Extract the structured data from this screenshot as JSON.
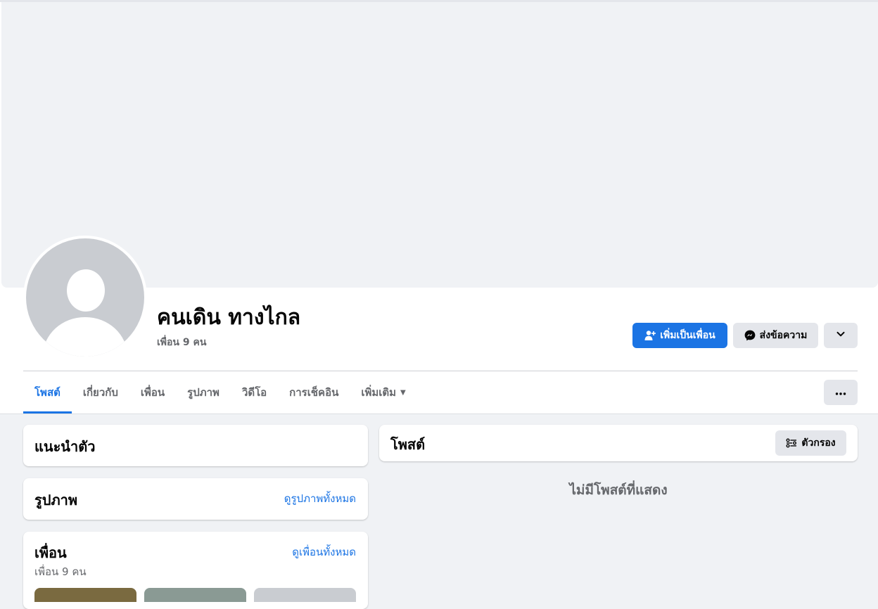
{
  "profile": {
    "name": "คนเดิน ทางไกล",
    "friend_count": "เพื่อน 9 คน"
  },
  "actions": {
    "add_friend": "เพิ่มเป็นเพื่อน",
    "message": "ส่งข้อความ"
  },
  "tabs": [
    {
      "label": "โพสต์"
    },
    {
      "label": "เกี่ยวกับ"
    },
    {
      "label": "เพื่อน"
    },
    {
      "label": "รูปภาพ"
    },
    {
      "label": "วิดีโอ"
    },
    {
      "label": "การเช็คอิน"
    },
    {
      "label": "เพิ่มเติม"
    }
  ],
  "intro": {
    "title": "แนะนำตัว"
  },
  "photos": {
    "title": "รูปภาพ",
    "see_all": "ดูรูปภาพทั้งหมด"
  },
  "friends": {
    "title": "เพื่อน",
    "see_all": "ดูเพื่อนทั้งหมด",
    "count": "เพื่อน 9 คน"
  },
  "posts": {
    "title": "โพสต์",
    "filter": "ตัวกรอง",
    "empty": "ไม่มีโพสต์ที่แสดง"
  },
  "colors": {
    "accent": "#1b74e4",
    "background": "#f0f2f5",
    "secondary_text": "#65676b"
  }
}
